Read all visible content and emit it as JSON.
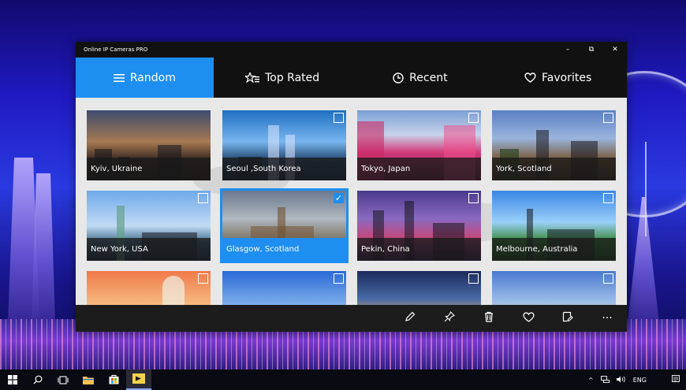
{
  "window": {
    "title": "Online IP Cameras PRO",
    "controls": {
      "minimize": "–",
      "restore": "⧉",
      "close": "✕"
    }
  },
  "tabs": [
    {
      "label": "Random",
      "icon": "hamburger-icon",
      "active": true
    },
    {
      "label": "Top Rated",
      "icon": "star-list-icon",
      "active": false
    },
    {
      "label": "Recent",
      "icon": "clock-icon",
      "active": false
    },
    {
      "label": "Favorites",
      "icon": "heart-icon",
      "active": false
    }
  ],
  "cameras": [
    {
      "caption": "Kyiv, Ukraine",
      "selected": false
    },
    {
      "caption": "Seoul ,South Korea",
      "selected": false
    },
    {
      "caption": "Tokyo, Japan",
      "selected": false
    },
    {
      "caption": "York, Scotland",
      "selected": false
    },
    {
      "caption": "New York, USA",
      "selected": false
    },
    {
      "caption": "Glasgow, Scotland",
      "selected": true
    },
    {
      "caption": "Pekin, China",
      "selected": false
    },
    {
      "caption": "Melbourne, Australia",
      "selected": false
    },
    {
      "caption": "",
      "selected": false
    },
    {
      "caption": "",
      "selected": false
    },
    {
      "caption": "",
      "selected": false
    },
    {
      "caption": "",
      "selected": false
    }
  ],
  "appbar": {
    "more_label": "···",
    "buttons": [
      "edit-icon",
      "pin-icon",
      "delete-icon",
      "favorite-icon",
      "rename-icon",
      "more-icon"
    ]
  },
  "taskbar": {
    "tray_language": "ENG",
    "tray_chevron": "^"
  },
  "colors": {
    "accent": "#1e8ef0",
    "titlebar": "#111111",
    "appbar": "#1c1c1c"
  }
}
